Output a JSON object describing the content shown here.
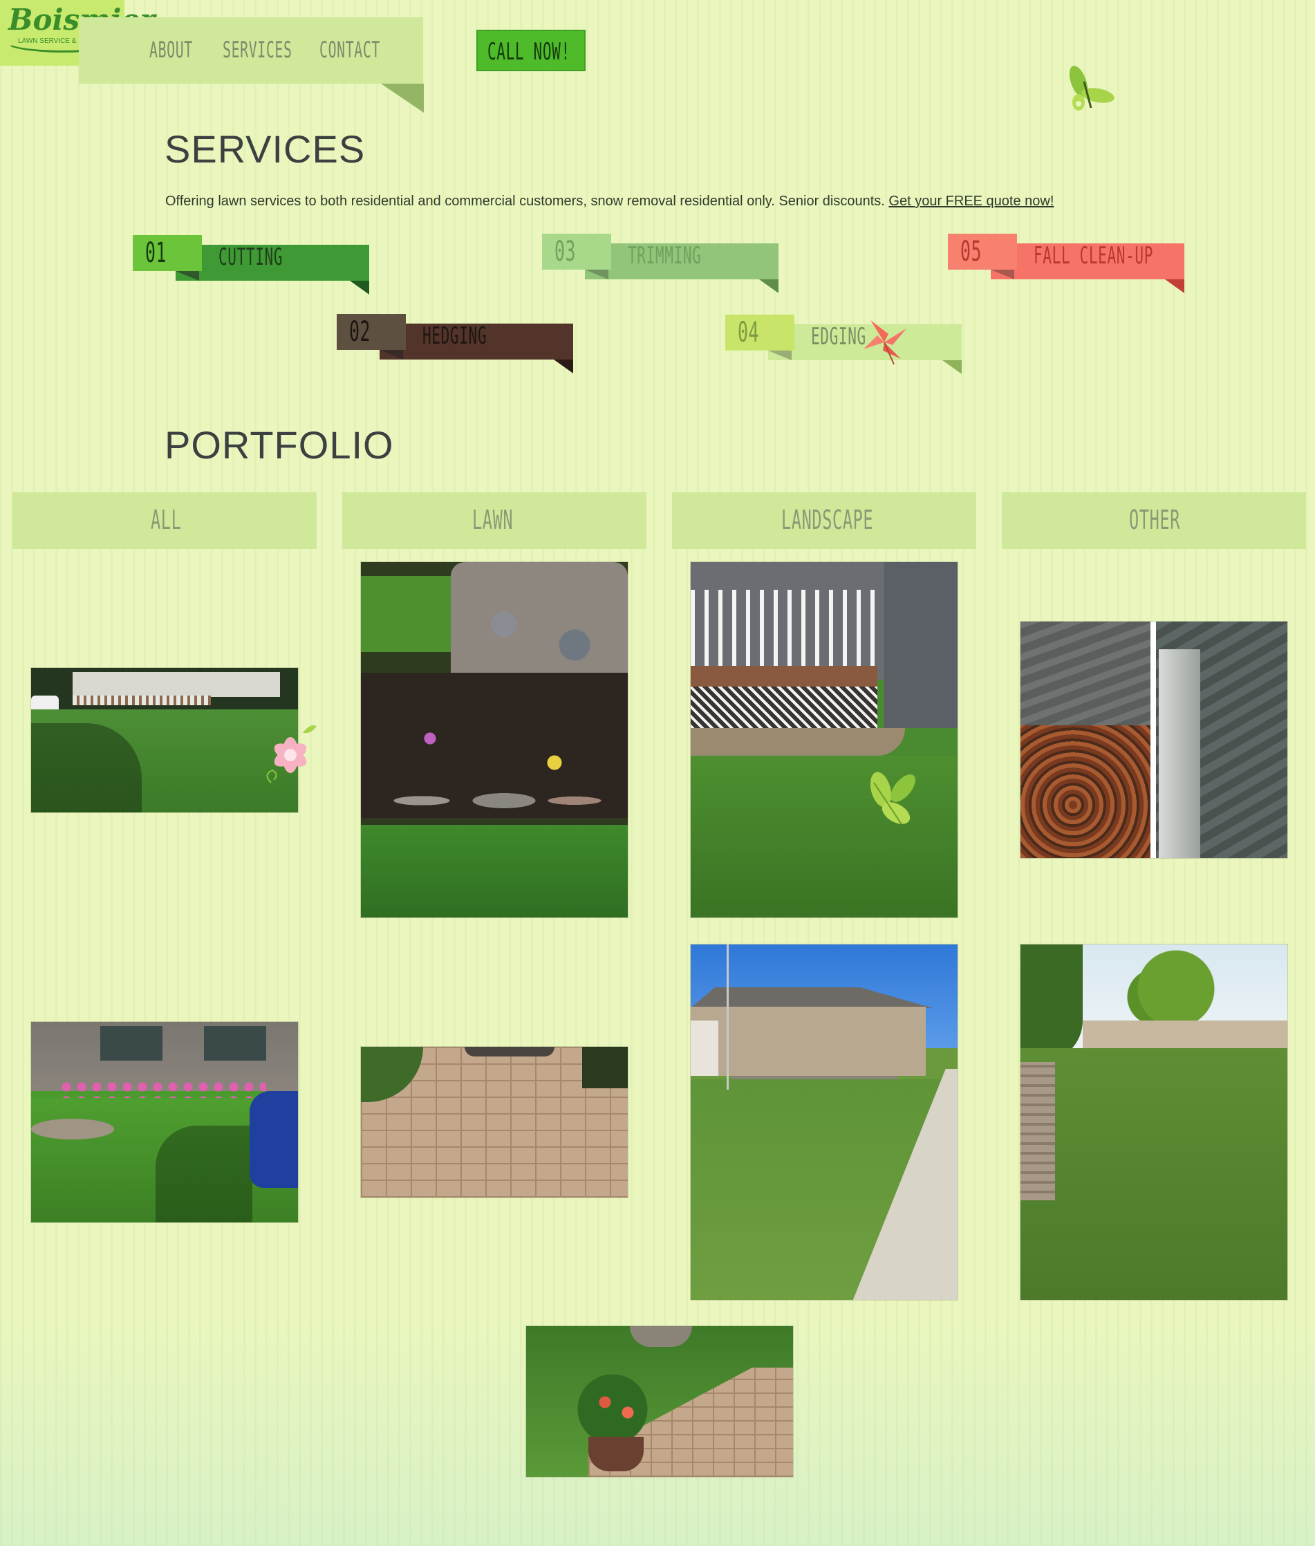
{
  "brand": {
    "name": "Boismier",
    "tagline": "LAWN SERVICE & SNOW REMOVAL"
  },
  "nav": {
    "items": [
      {
        "label": "ABOUT"
      },
      {
        "label": "SERVICES"
      },
      {
        "label": "CONTACT"
      }
    ],
    "cta_label": "CALL NOW!"
  },
  "services": {
    "title": "SERVICES",
    "description": "Offering lawn services to both residential and commercial customers, snow removal residential only. Senior discounts.",
    "quote_link": "Get your FREE quote now!",
    "items": [
      {
        "number": "01",
        "label": "CUTTING",
        "color": "#3f9a36",
        "num_color": "#6cc43a"
      },
      {
        "number": "02",
        "label": "HEDGING",
        "color": "#52342a",
        "num_color": "#5e5040"
      },
      {
        "number": "03",
        "label": "TRIMMING",
        "color": "#92c47a",
        "num_color": "#a8d88a"
      },
      {
        "number": "04",
        "label": "EDGING",
        "color": "#cdea98",
        "num_color": "#c8e56a"
      },
      {
        "number": "05",
        "label": "FALL CLEAN-UP",
        "color": "#f57467",
        "num_color": "#f7806e"
      }
    ]
  },
  "portfolio": {
    "title": "PORTFOLIO",
    "filters": [
      {
        "label": "ALL"
      },
      {
        "label": "LAWN"
      },
      {
        "label": "LANDSCAPE"
      },
      {
        "label": "OTHER"
      }
    ],
    "photos": [
      {
        "subject": "house-lawn-deck"
      },
      {
        "subject": "stone-pillar-flowerbed"
      },
      {
        "subject": "porch-retaining-wall"
      },
      {
        "subject": "gutter-cleaning"
      },
      {
        "subject": "front-yard-garden"
      },
      {
        "subject": "paver-walkway"
      },
      {
        "subject": "ranch-house-lawn"
      },
      {
        "subject": "backyard-tree"
      },
      {
        "subject": "paver-path-planter"
      }
    ]
  }
}
